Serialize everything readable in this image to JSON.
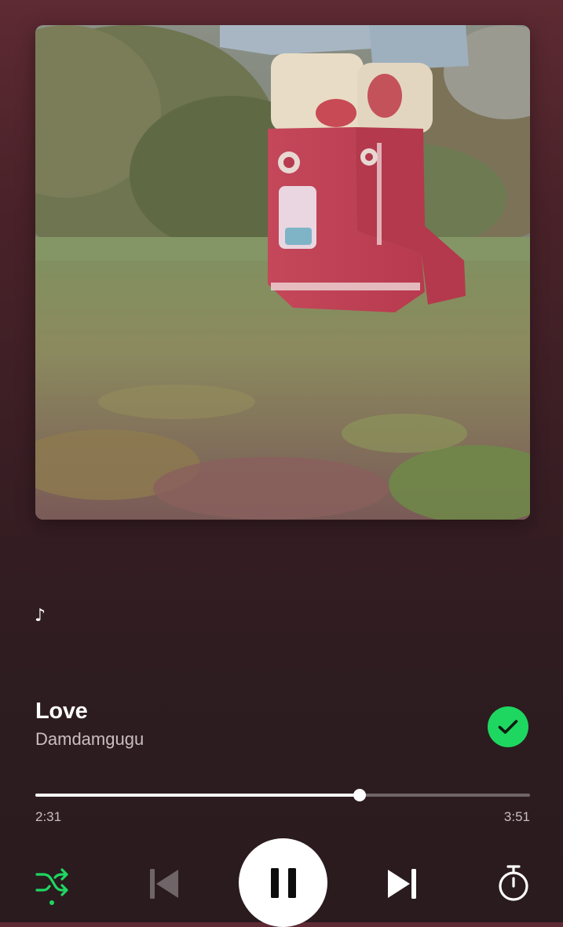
{
  "player": {
    "lyric_note": "♪",
    "track_title": "Love",
    "track_artist": "Damdamgugu",
    "liked": true,
    "progress": {
      "elapsed": "2:31",
      "total": "3:51",
      "fraction": 0.656
    },
    "shuffle_enabled": true
  },
  "icons": {
    "liked": "check-circle-icon",
    "shuffle": "shuffle-icon",
    "previous": "skip-previous-icon",
    "play_pause": "pause-icon",
    "next": "skip-next-icon",
    "timer": "sleep-timer-icon"
  },
  "colors": {
    "accent": "#1ed760",
    "background_top": "#5e2a33",
    "background_bottom": "#2a1b1f",
    "secondary_text": "#c9bec0"
  }
}
